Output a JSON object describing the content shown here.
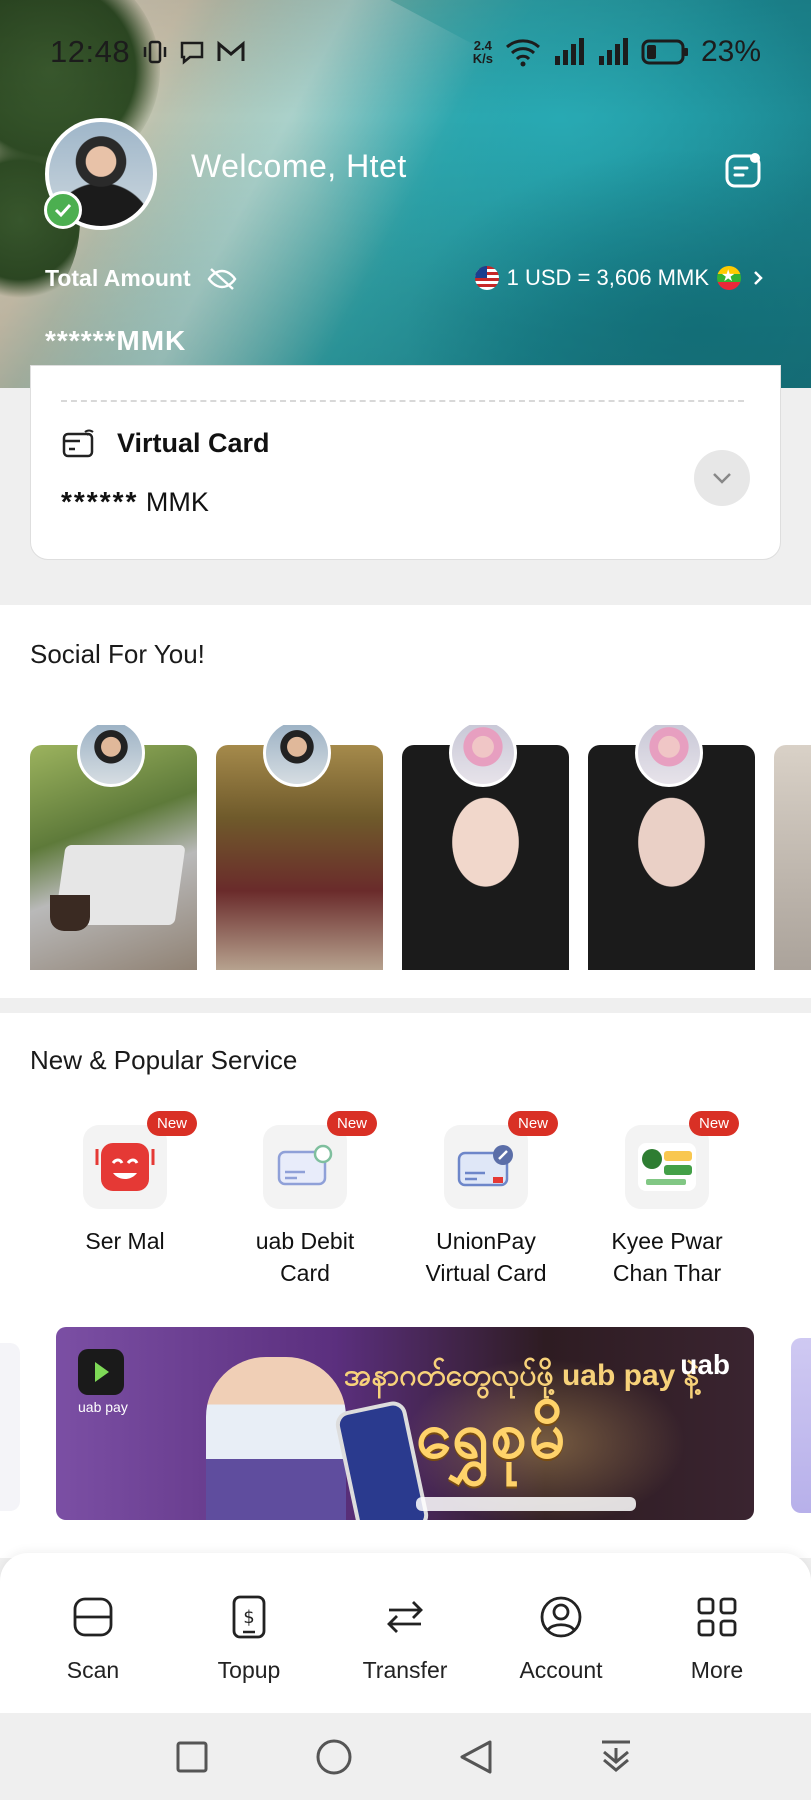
{
  "status_bar": {
    "time": "12:48",
    "network_speed_value": "2.4",
    "network_speed_unit": "K/s",
    "battery": "23%"
  },
  "header": {
    "welcome": "Welcome, Htet",
    "total_amount_label": "Total Amount",
    "masked_amount": "******",
    "currency": "MMK",
    "exchange_rate": "1 USD = 3,606 MMK"
  },
  "virtual_card": {
    "title": "Virtual Card",
    "masked_amount": "******",
    "currency": "MMK"
  },
  "social": {
    "title": "Social For You!"
  },
  "services": {
    "title": "New & Popular Service",
    "items": [
      {
        "label_line1": "Ser Mal",
        "label_line2": "",
        "badge": "New"
      },
      {
        "label_line1": "uab Debit",
        "label_line2": "Card",
        "badge": "New"
      },
      {
        "label_line1": "UnionPay",
        "label_line2": "Virtual Card",
        "badge": "New"
      },
      {
        "label_line1": "Kyee Pwar",
        "label_line2": "Chan Thar",
        "badge": "New"
      }
    ]
  },
  "banner": {
    "app_name": "uab pay",
    "brand": "uab",
    "headline": "အနာဂတ်တွေလုပ်ဖို့ uab pay နဲ့",
    "big_text": "ရွှေစုမိ"
  },
  "bottom_nav": {
    "items": [
      {
        "label": "Scan"
      },
      {
        "label": "Topup"
      },
      {
        "label": "Transfer"
      },
      {
        "label": "Account"
      },
      {
        "label": "More"
      }
    ]
  },
  "colors": {
    "badge": "#d93025",
    "verified": "#4caf50",
    "header_sea": "#1d8e98"
  }
}
